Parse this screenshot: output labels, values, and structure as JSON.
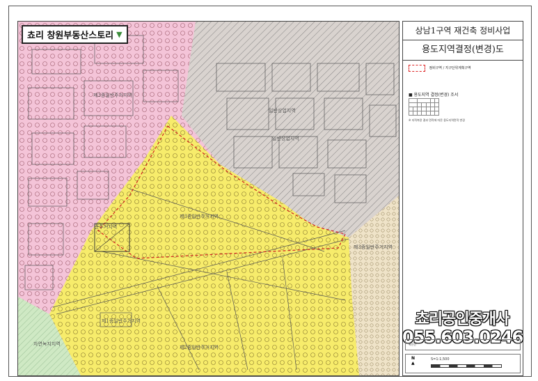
{
  "brand": {
    "name": "쵸리 창원부동산스토리",
    "marker_icon": "green-triangle-down-icon"
  },
  "panel": {
    "project_title": "상남1구역 재건축 정비사업",
    "map_title": "용도지역결정(변경)도",
    "legend_label": "정비구역 / 지구단위계획구역",
    "table_title": "■  용도지역 결정(변경) 조서",
    "note": "※ 지적측량 결과 면적에 따른 용도지역면적 변경",
    "sign_label": "확인란",
    "scale": "S=1:1,500"
  },
  "advert": {
    "line1": "쵸리공인중개사",
    "line2": "055.603.0246"
  },
  "map_labels": {
    "zone_1": "제3종일반주거지역",
    "zone_2": "일반상업지역",
    "zone_3": "일반상업지역",
    "zone_4": "제3종일반주거지역",
    "zone_5": "준주거지역",
    "zone_6": "제1종일반주거지역",
    "zone_7": "자연녹지지역",
    "zone_8": "제2종일반주거지역",
    "zone_9": "제3종일반주거지역"
  },
  "colors": {
    "residential_pink": "#f4c4d8",
    "commercial_grey": "#d9d3cf",
    "residential_yellow": "#f7ec6b",
    "green": "#cfe9c4",
    "boundary_red": "#d02020"
  }
}
